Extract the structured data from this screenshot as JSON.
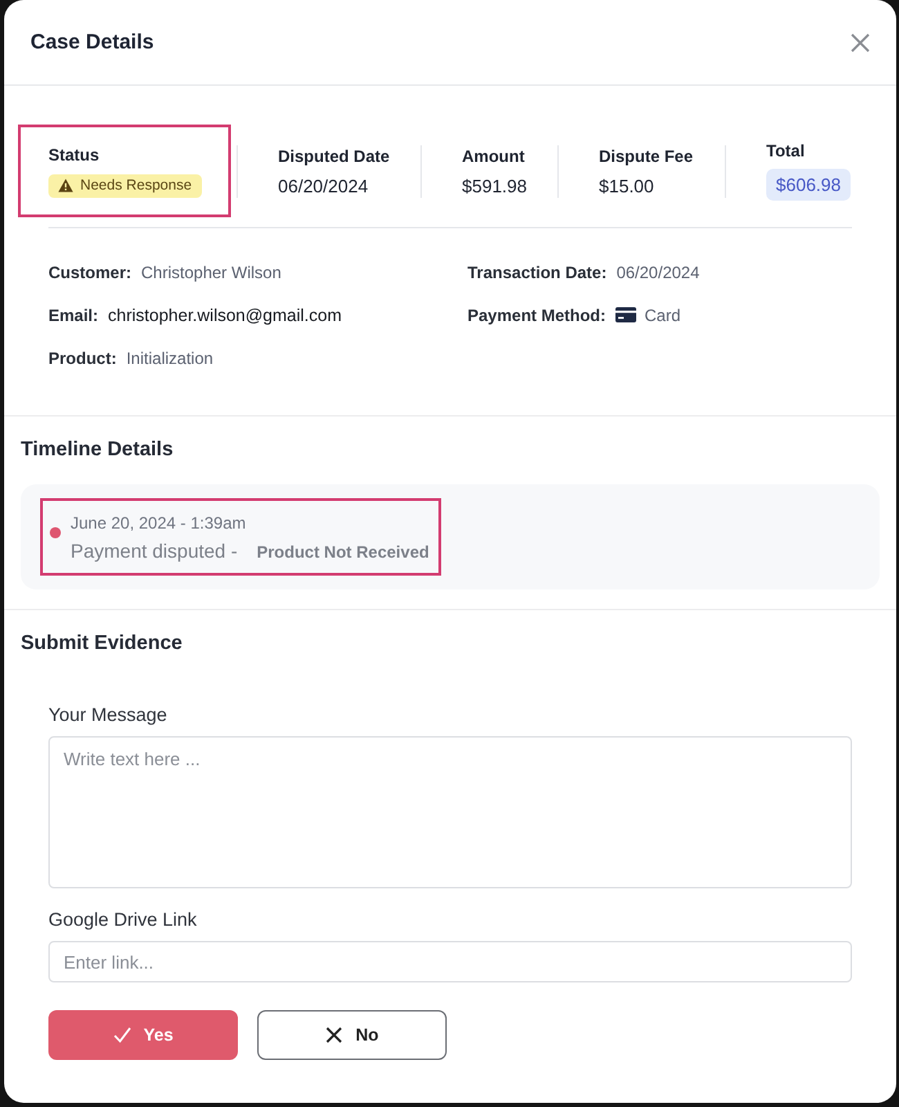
{
  "dialog": {
    "title": "Case Details"
  },
  "summary": [
    {
      "kind": "status",
      "label": "Status",
      "value": "Needs Response",
      "highlighted": true
    },
    {
      "kind": "plain",
      "label": "Disputed Date",
      "value": "06/20/2024",
      "highlighted": false
    },
    {
      "kind": "plain",
      "label": "Amount",
      "value": "$591.98",
      "highlighted": false
    },
    {
      "kind": "plain",
      "label": "Dispute Fee",
      "value": "$15.00",
      "highlighted": false
    },
    {
      "kind": "total",
      "label": "Total",
      "value": "$606.98",
      "highlighted": false
    }
  ],
  "details": [
    {
      "kind": "text",
      "label": "Customer:",
      "value": "Christopher Wilson"
    },
    {
      "kind": "text",
      "label": "Transaction Date:",
      "value": "06/20/2024"
    },
    {
      "kind": "email",
      "label": "Email:",
      "value": "christopher.wilson@gmail.com"
    },
    {
      "kind": "card",
      "label": "Payment Method:",
      "value": "Card"
    },
    {
      "kind": "text",
      "label": "Product:",
      "value": "Initialization"
    }
  ],
  "timeline": {
    "title": "Timeline Details",
    "events": [
      {
        "time": "June 20, 2024 - 1:39am",
        "event": "Payment disputed -",
        "reason": "Product Not Received",
        "highlighted": true
      }
    ]
  },
  "evidence": {
    "title": "Submit Evidence",
    "fields": [
      {
        "kind": "textarea",
        "label": "Your Message",
        "placeholder": "Write text here ..."
      },
      {
        "kind": "input",
        "label": "Google Drive Link",
        "placeholder": "Enter link..."
      }
    ],
    "buttons": [
      {
        "kind": "confirm",
        "label": "Yes"
      },
      {
        "kind": "cancel",
        "label": "No"
      }
    ]
  }
}
